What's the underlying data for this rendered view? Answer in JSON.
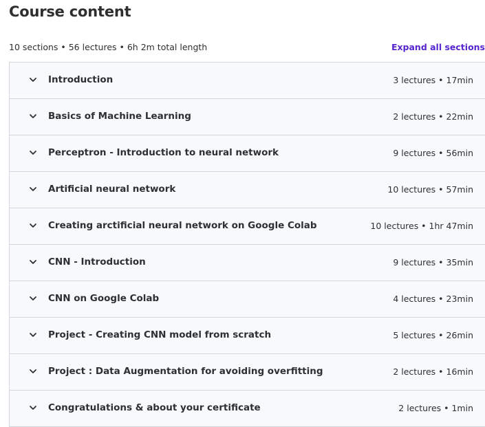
{
  "header": {
    "title": "Course content",
    "summary": "10 sections • 56 lectures • 6h 2m total length",
    "expand_label": "Expand all sections"
  },
  "colors": {
    "accent": "#5624d0",
    "row_background": "#f7f9fa",
    "border": "#d1d7dc",
    "text": "#2d2f31"
  },
  "sections": [
    {
      "title": "Introduction",
      "meta": "3 lectures • 17min",
      "icon": "chevron-down-icon"
    },
    {
      "title": "Basics of Machine Learning",
      "meta": "2 lectures • 22min",
      "icon": "chevron-down-icon"
    },
    {
      "title": "Perceptron - Introduction to neural network",
      "meta": "9 lectures • 56min",
      "icon": "chevron-down-icon"
    },
    {
      "title": "Artificial neural network",
      "meta": "10 lectures • 57min",
      "icon": "chevron-down-icon"
    },
    {
      "title": "Creating arctificial neural network on Google Colab",
      "meta": "10 lectures • 1hr 47min",
      "icon": "chevron-down-icon"
    },
    {
      "title": "CNN - Introduction",
      "meta": "9 lectures • 35min",
      "icon": "chevron-down-icon"
    },
    {
      "title": "CNN on Google Colab",
      "meta": "4 lectures • 23min",
      "icon": "chevron-down-icon"
    },
    {
      "title": "Project - Creating CNN model from scratch",
      "meta": "5 lectures • 26min",
      "icon": "chevron-down-icon"
    },
    {
      "title": "Project : Data Augmentation for avoiding overfitting",
      "meta": "2 lectures • 16min",
      "icon": "chevron-down-icon"
    },
    {
      "title": "Congratulations & about your certificate",
      "meta": "2 lectures • 1min",
      "icon": "chevron-down-icon"
    }
  ]
}
